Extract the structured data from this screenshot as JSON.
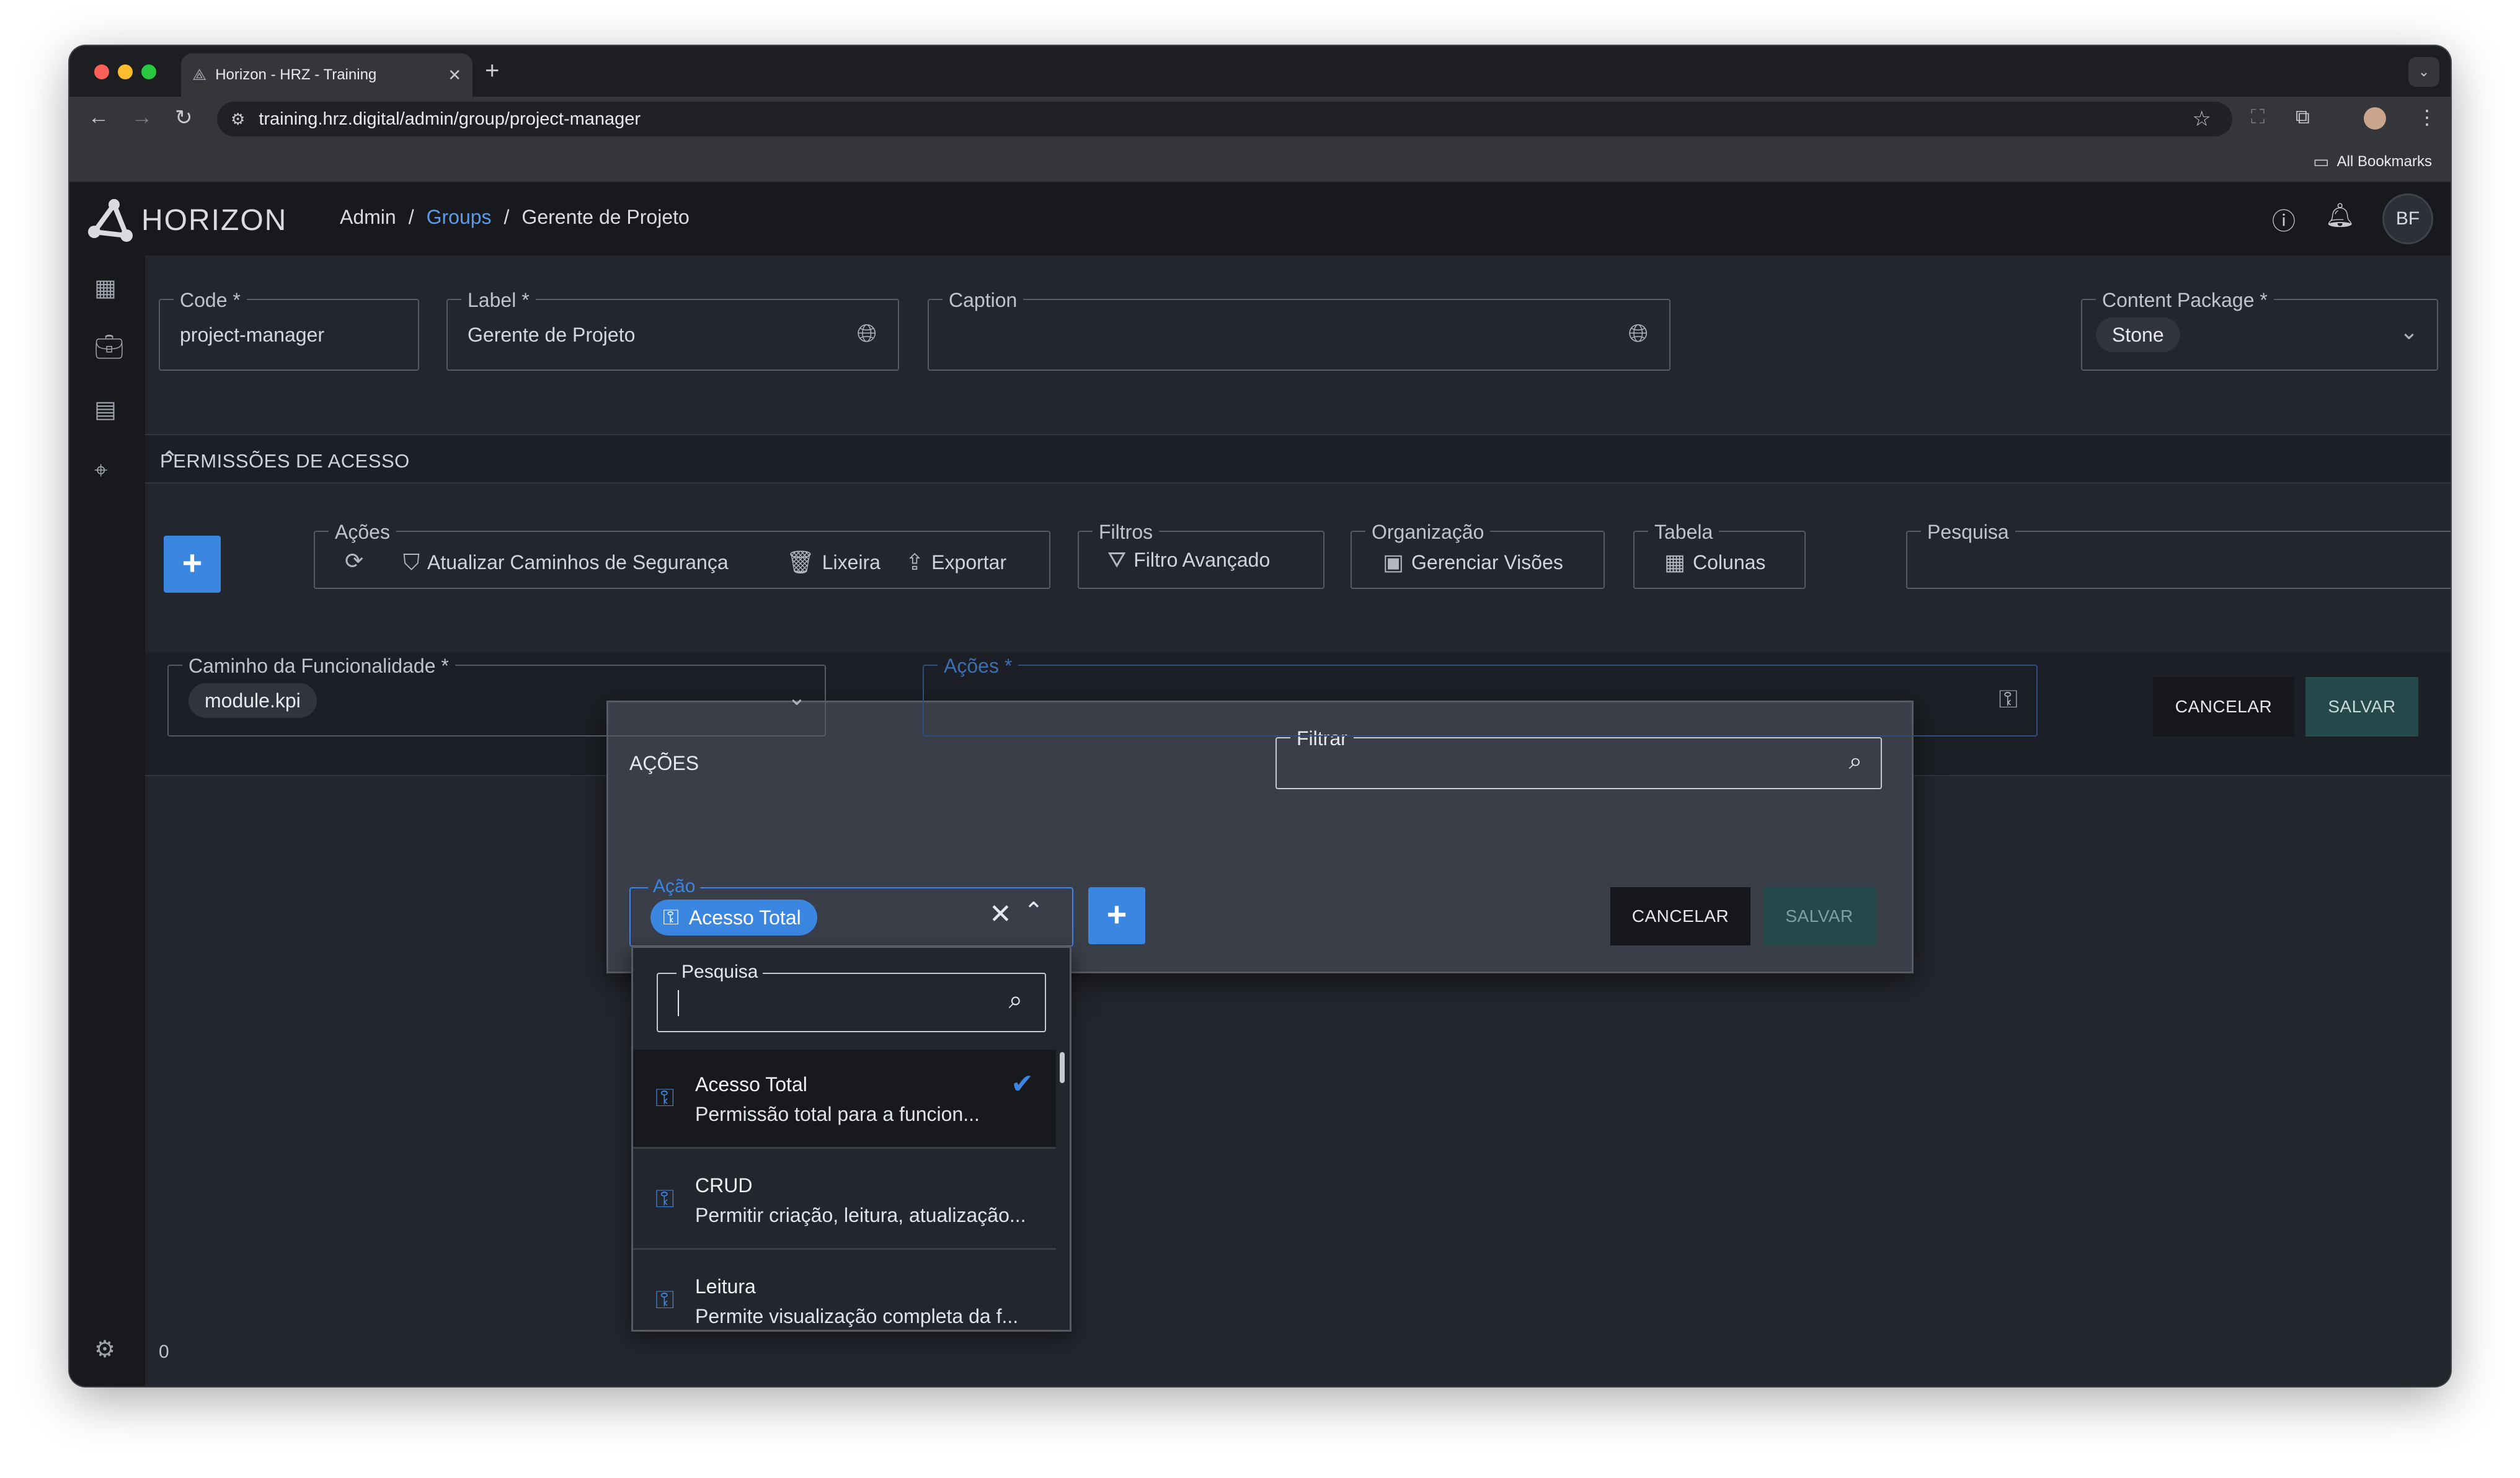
{
  "browser": {
    "tab_title": "Horizon - HRZ - Training",
    "url": "training.hrz.digital/admin/group/project-manager",
    "bookmarks_label": "All Bookmarks"
  },
  "app": {
    "brand": "HORIZON",
    "breadcrumb": [
      "Admin",
      "/",
      "Groups",
      "/",
      "Gerente de Projeto"
    ],
    "user_initials": "BF"
  },
  "form": {
    "code_label": "Code *",
    "code_value": "project-manager",
    "label_label": "Label *",
    "label_value": "Gerente de Projeto",
    "caption_label": "Caption",
    "caption_value": "",
    "content_package_label": "Content Package *",
    "content_package_value": "Stone"
  },
  "permissions": {
    "section_title": "PERMISSÕES DE ACESSO",
    "acoes_group": "Ações",
    "update_paths": "Atualizar Caminhos de Segurança",
    "trash": "Lixeira",
    "export": "Exportar",
    "filters_group": "Filtros",
    "advanced_filter": "Filtro Avançado",
    "organization_group": "Organização",
    "manage_views": "Gerenciar Visões",
    "table_group": "Tabela",
    "columns": "Colunas",
    "search_label": "Pesquisa",
    "path_label": "Caminho da Funcionalidade *",
    "path_value": "module.kpi",
    "actions_label": "Ações *",
    "cancel": "CANCELAR",
    "save": "SALVAR",
    "row_count": "0"
  },
  "modal": {
    "title": "AÇÕES",
    "filter_label": "Filtrar",
    "action_label": "Ação",
    "selected_action": "Acesso Total",
    "cancel": "CANCELAR",
    "save": "SALVAR"
  },
  "dropdown": {
    "search_label": "Pesquisa",
    "options": [
      {
        "title": "Acesso Total",
        "desc": "Permissão total para a funcion...",
        "selected": true
      },
      {
        "title": "CRUD",
        "desc": "Permitir criação, leitura, atualização...",
        "selected": false
      },
      {
        "title": "Leitura",
        "desc": "Permite visualização completa da f...",
        "selected": false
      }
    ]
  },
  "colors": {
    "accent": "#3b86e0",
    "teal_button": "#25484b",
    "background": "#23262d",
    "header": "#17191d"
  }
}
